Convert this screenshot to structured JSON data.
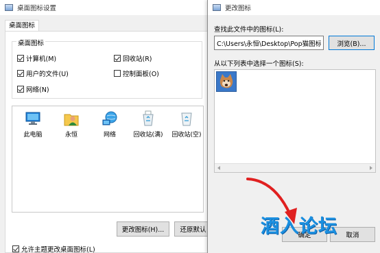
{
  "left_window": {
    "title": "桌面图标设置",
    "tab": "桌面图标",
    "group_title": "桌面图标",
    "checkboxes": [
      {
        "label": "计算机(M)",
        "checked": true
      },
      {
        "label": "回收站(R)",
        "checked": true
      },
      {
        "label": "用户的文件(U)",
        "checked": true
      },
      {
        "label": "控制面板(O)",
        "checked": false
      },
      {
        "label": "网络(N)",
        "checked": true
      }
    ],
    "icons": [
      {
        "label": "此电脑",
        "icon": "computer-icon"
      },
      {
        "label": "永恒",
        "icon": "user-folder-icon"
      },
      {
        "label": "网络",
        "icon": "network-icon"
      },
      {
        "label": "回收站(满)",
        "icon": "recycle-bin-full-icon"
      },
      {
        "label": "回收站(空)",
        "icon": "recycle-bin-empty-icon"
      }
    ],
    "change_icon_button": "更改图标(H)...",
    "restore_default_button": "还原默认",
    "allow_theme_label": "允许主题更改桌面图标(L)",
    "allow_theme_checked": true
  },
  "right_window": {
    "title": "更改图标",
    "find_label": "查找此文件中的图标(L):",
    "path_value": "C:\\Users\\永恒\\Desktop\\Pop猫图标\\P",
    "browse_button": "浏览(B)...",
    "list_label": "从以下列表中选择一个图标(S):",
    "selected_icon": "cat-icon",
    "ok_button": "确定",
    "cancel_button": "取消"
  },
  "watermark": "酒入论坛",
  "colors": {
    "accent": "#1a8fe0",
    "arrow": "#e02020",
    "selection": "#3a78c9"
  }
}
